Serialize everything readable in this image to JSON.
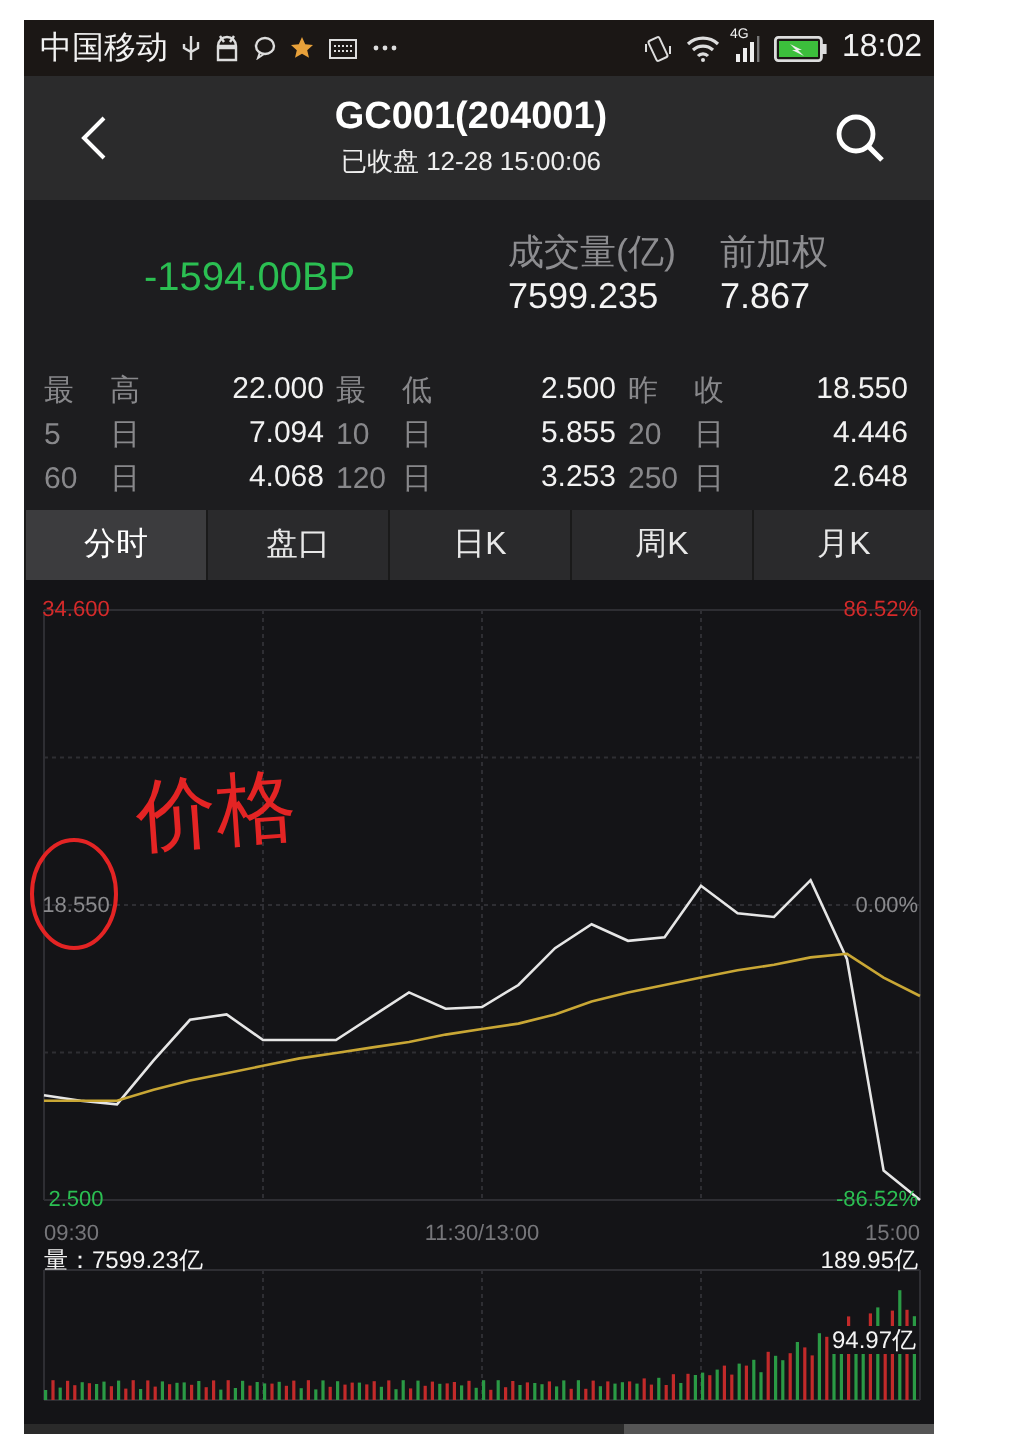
{
  "status_bar": {
    "carrier": "中国移动",
    "network": "4G",
    "time": "18:02"
  },
  "header": {
    "title": "GC001(204001)",
    "subtitle": "已收盘 12-28 15:00:06"
  },
  "quote": {
    "change": "-1594.00BP",
    "figures": [
      {
        "label": "成交量(亿)",
        "value": "7599.235"
      },
      {
        "label": "前加权",
        "value": "7.867"
      }
    ]
  },
  "stats": [
    [
      {
        "label": "最 高",
        "value": "22.000"
      },
      {
        "label": "最 低",
        "value": "2.500"
      },
      {
        "label": "昨 收",
        "value": "18.550"
      }
    ],
    [
      {
        "label": "5 日",
        "value": "7.094"
      },
      {
        "label": "10 日",
        "value": "5.855"
      },
      {
        "label": "20 日",
        "value": "4.446"
      }
    ],
    [
      {
        "label": "60 日",
        "value": "4.068"
      },
      {
        "label": "120 日",
        "value": "3.253"
      },
      {
        "label": "250 日",
        "value": "2.648"
      }
    ]
  ],
  "tabs": [
    {
      "label": "分时",
      "selected": true
    },
    {
      "label": "盘口",
      "selected": false
    },
    {
      "label": "日K",
      "selected": false
    },
    {
      "label": "周K",
      "selected": false
    },
    {
      "label": "月K",
      "selected": false
    }
  ],
  "chart": {
    "chart_data": {
      "type": "line",
      "categories": [
        null,
        null,
        null,
        null,
        null,
        null,
        null,
        null,
        null,
        null,
        null,
        null,
        null,
        null,
        null,
        null,
        null,
        null,
        null,
        null,
        null,
        null,
        null,
        null,
        null
      ],
      "series": [
        {
          "color": "#e6e6e6",
          "values": [
            8.2,
            7.9,
            7.7,
            10.1,
            12.3,
            12.6,
            11.2,
            11.2,
            11.2,
            12.5,
            13.8,
            12.9,
            13.0,
            14.2,
            16.2,
            17.5,
            16.6,
            16.8,
            19.6,
            18.1,
            17.9,
            19.9,
            15.6,
            4.1,
            2.5
          ]
        },
        {
          "color": "#c9a735",
          "values": [
            7.9,
            7.9,
            7.9,
            8.5,
            9.0,
            9.4,
            9.8,
            10.2,
            10.5,
            10.8,
            11.1,
            11.5,
            11.8,
            12.1,
            12.6,
            13.3,
            13.8,
            14.2,
            14.6,
            15.0,
            15.3,
            15.7,
            15.9,
            14.6,
            13.6
          ]
        }
      ],
      "ylim": [
        2.5,
        34.6
      ],
      "grid": true,
      "yticks": [
        {
          "value": 2.5,
          "label": "2.500"
        },
        {
          "value": 18.55,
          "label": "18.550"
        },
        {
          "value": 34.6,
          "label": "34.600"
        }
      ]
    },
    "time_labels": [
      "09:30",
      "11:30/13:00",
      "15:00"
    ],
    "right_labels": [
      {
        "label": "86.52%",
        "color": "#d42a2a"
      },
      {
        "label": "0.00%",
        "color": "#8a8a8d"
      },
      {
        "label": "-86.52%",
        "color": "#2bbf52"
      }
    ],
    "volume": {
      "total": "量：7599.23亿",
      "max": "189.95亿",
      "mid": "94.97亿"
    },
    "annotation": {
      "text": "价格"
    }
  }
}
